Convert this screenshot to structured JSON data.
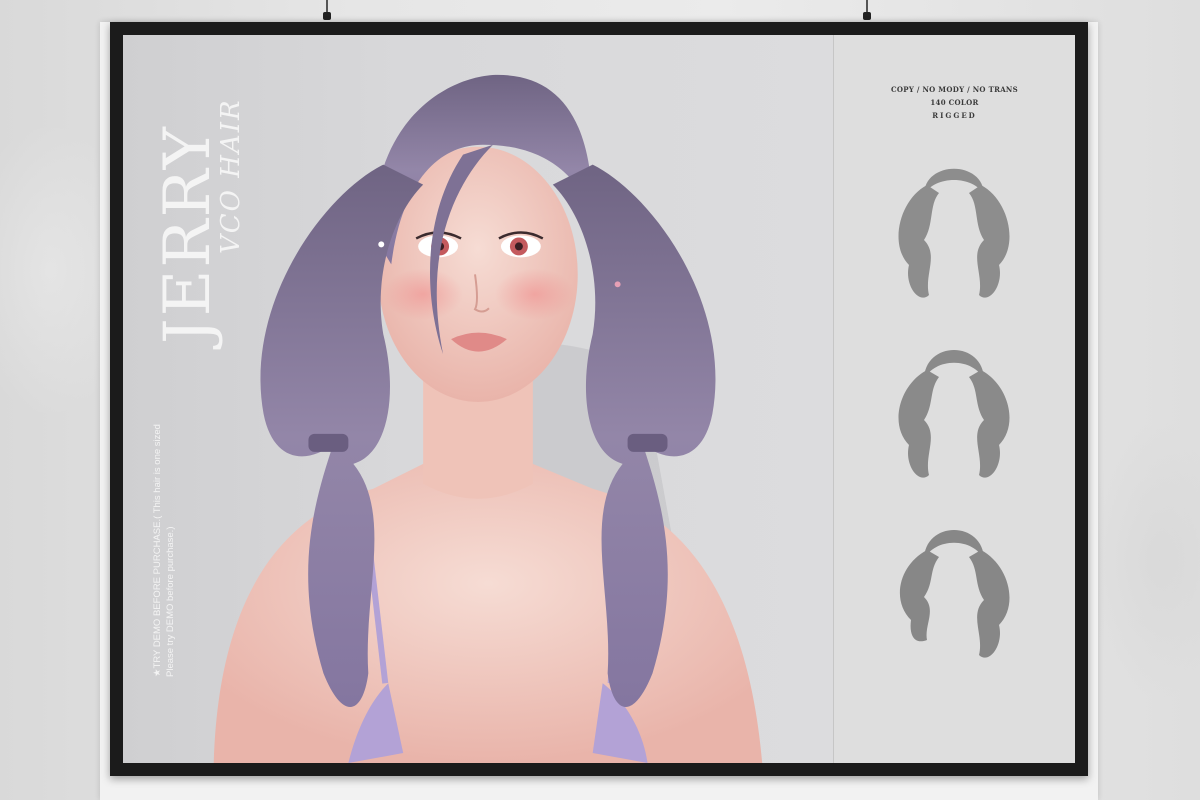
{
  "poster": {
    "brand": "JERRY",
    "subtitle": "VCO HAIR",
    "notes": [
      "★TRY DEMO BEFORE PURCHASE.( This hair is one sized",
      "Please try DEMO before purchase.)"
    ],
    "info": {
      "permissions": "COPY / NO MODY / NO TRANS",
      "colors": "140 COLOR",
      "rigged": "RIGGED"
    }
  },
  "colors": {
    "hair": "#8a7ca0",
    "frame": "#1b1b1b",
    "wall": "#e4e4e4",
    "skin": "#f0c8c0",
    "top": "#b3a2d6"
  },
  "hair_styles": [
    {
      "id": "style-1"
    },
    {
      "id": "style-2"
    },
    {
      "id": "style-3"
    }
  ]
}
